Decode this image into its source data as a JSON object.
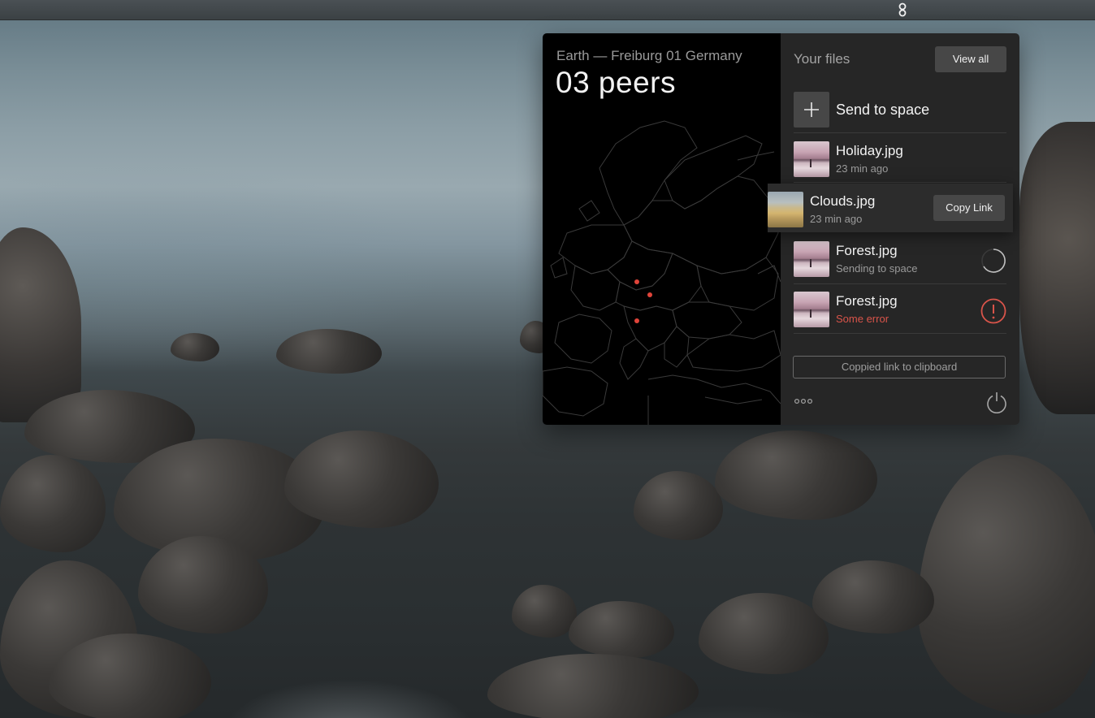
{
  "map": {
    "location": "Earth — Freiburg 01 Germany",
    "peers": "03 peers",
    "peer_color": "#e0443a"
  },
  "files": {
    "title": "Your files",
    "view_all_label": "View all",
    "send_label": "Send to space",
    "items": [
      {
        "name": "Holiday.jpg",
        "sub": "23 min ago",
        "thumb": "pink"
      },
      {
        "name": "Clouds.jpg",
        "sub": "23 min ago",
        "thumb": "gold",
        "action": "Copy Link"
      },
      {
        "name": "Forest.jpg",
        "sub": "Sending to space",
        "thumb": "pink",
        "status": "loading"
      },
      {
        "name": "Forest.jpg",
        "sub": "Some error",
        "thumb": "pink",
        "status": "error"
      }
    ],
    "toast": "Coppied link to clipboard"
  },
  "colors": {
    "error": "#d9544a",
    "panel_right": "#262626",
    "panel_left": "#000000",
    "button": "#474747"
  },
  "icons": {
    "menubar": "app-tray-icon",
    "add": "plus-icon",
    "loading": "spinner-icon",
    "error": "alert-circle-icon",
    "more": "more-dots-icon",
    "power": "power-icon"
  }
}
